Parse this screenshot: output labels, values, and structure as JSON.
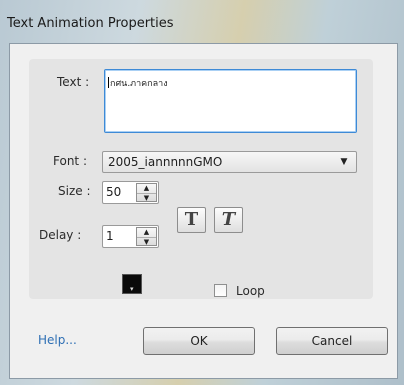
{
  "window": {
    "title": "Text Animation Properties"
  },
  "form": {
    "text_label": "Text :",
    "text_value": "กศน.ภาคกลาง",
    "font_label": "Font :",
    "font_value": "2005_iannnnnGMO",
    "size_label": "Size :",
    "size_value": "50",
    "delay_label": "Delay :",
    "delay_value": "1",
    "bold_glyph": "T",
    "italic_glyph": "T",
    "loop_label": "Loop",
    "loop_checked": false,
    "color_value": "#0a0a0a"
  },
  "footer": {
    "help_label": "Help...",
    "ok_label": "OK",
    "cancel_label": "Cancel"
  },
  "icons": {
    "dropdown": "chevron-down-icon",
    "spin_up": "arrow-up-icon",
    "spin_down": "arrow-down-icon"
  }
}
